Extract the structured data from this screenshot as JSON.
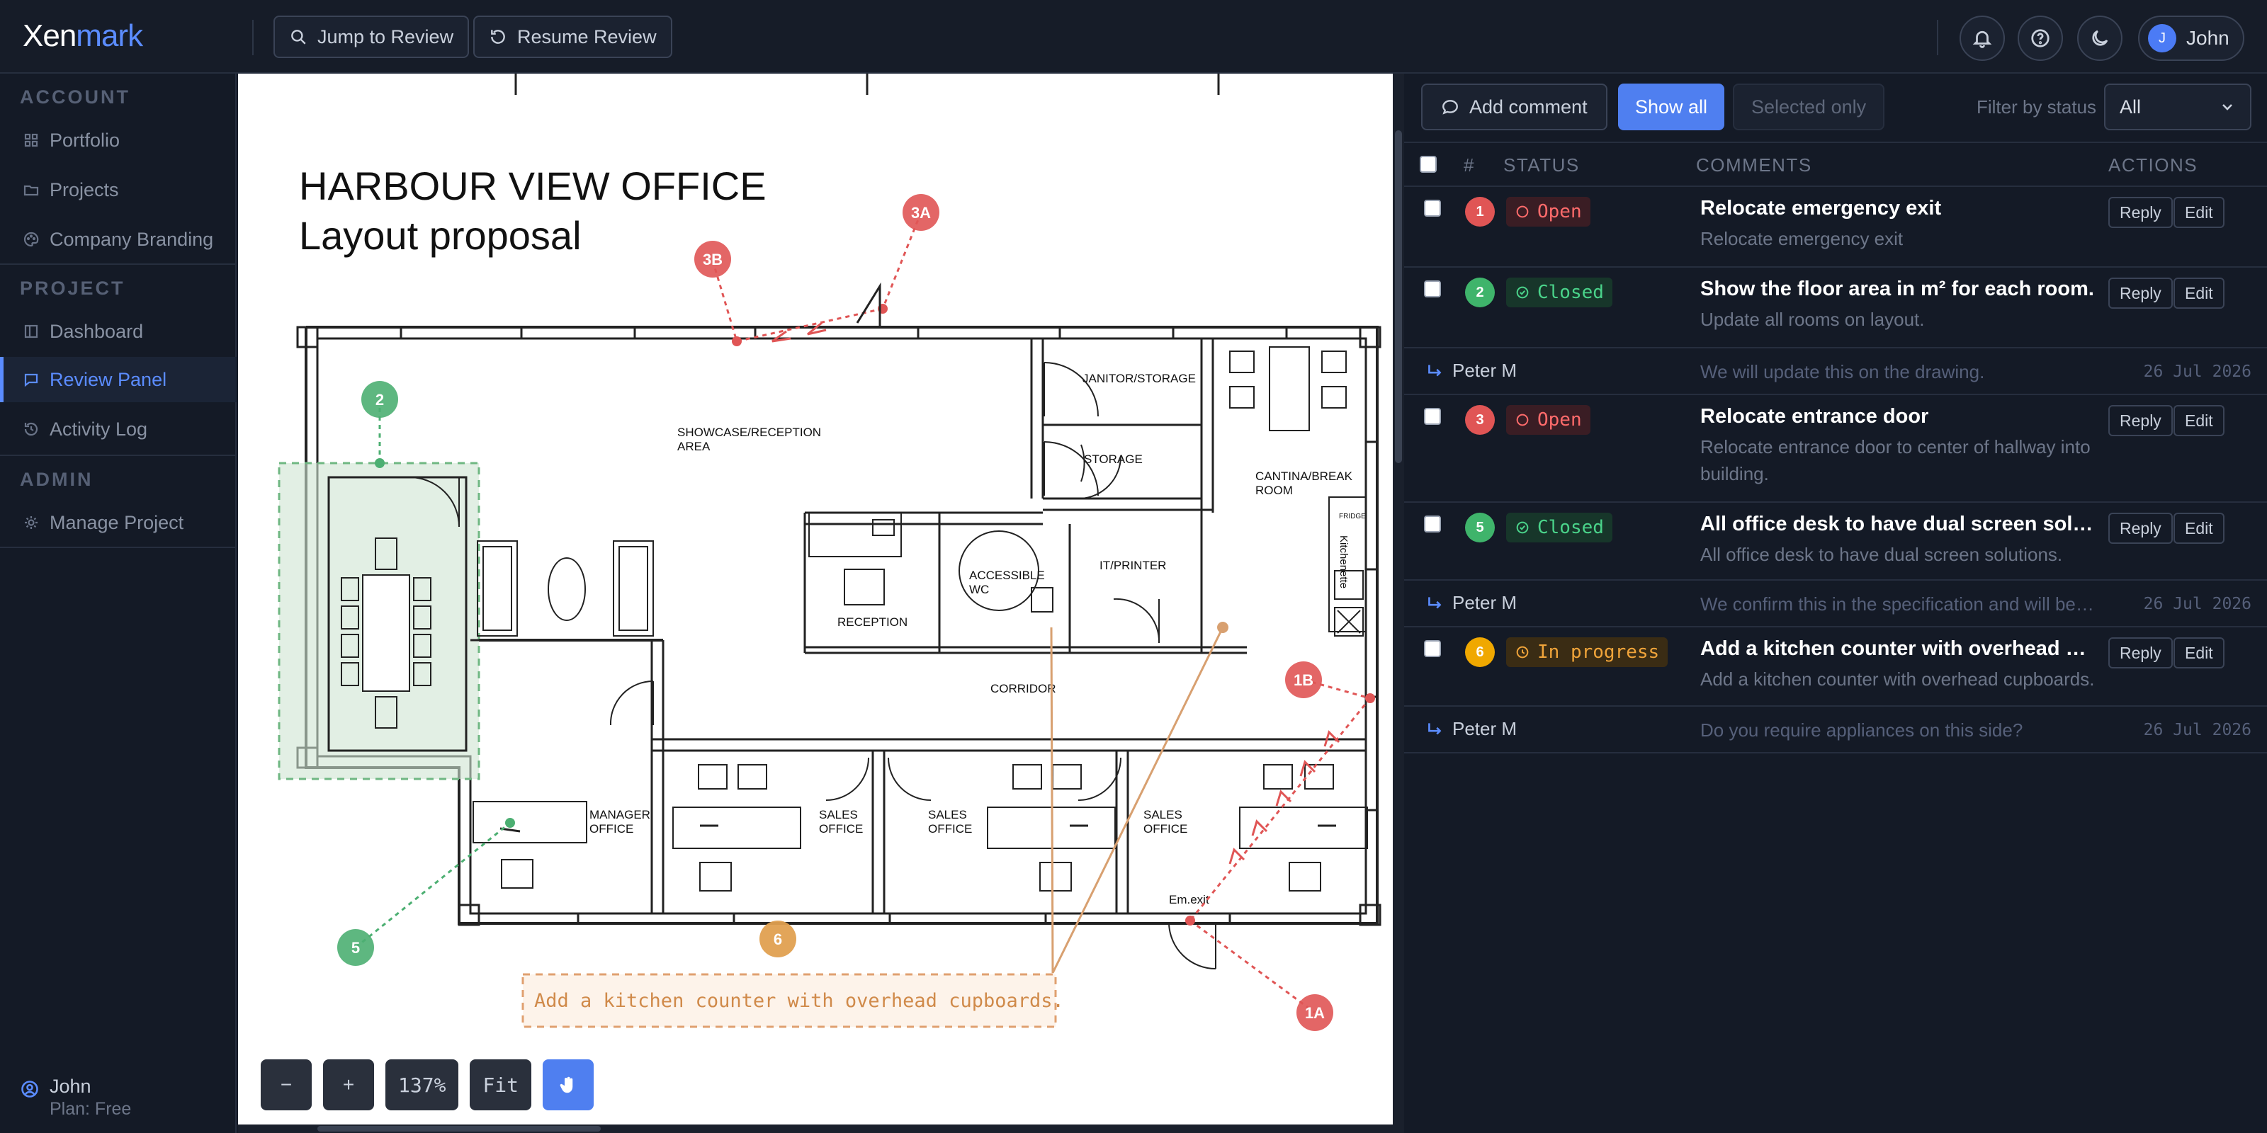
{
  "app": {
    "logo_text": "Xen",
    "logo_accent": "mark"
  },
  "toolbar": {
    "jump_label": "Jump to Review",
    "resume_label": "Resume Review",
    "bell_icon": "bell-icon",
    "help_icon": "help-icon",
    "theme_icon": "moon-icon",
    "user_name": "John",
    "user_initial": "J"
  },
  "sidebar": {
    "sections": [
      {
        "title": "ACCOUNT",
        "items": [
          {
            "label": "Portfolio",
            "icon": "grid-icon"
          },
          {
            "label": "Projects",
            "icon": "folder-icon"
          },
          {
            "label": "Company Branding",
            "icon": "palette-icon"
          }
        ]
      },
      {
        "title": "PROJECT",
        "items": [
          {
            "label": "Dashboard",
            "icon": "layout-icon"
          },
          {
            "label": "Review Panel",
            "icon": "comment-icon",
            "active": true
          },
          {
            "label": "Activity Log",
            "icon": "history-icon"
          }
        ]
      },
      {
        "title": "ADMIN",
        "items": [
          {
            "label": "Manage Project",
            "icon": "gear-icon"
          }
        ]
      }
    ],
    "user": {
      "name": "John",
      "plan": "Plan: Free"
    }
  },
  "drawing": {
    "title_line1": "HARBOUR VIEW OFFICE",
    "title_line2": "Layout proposal",
    "rooms": {
      "showcase": [
        "SHOWCASE/RECEPTION",
        "AREA"
      ],
      "janitor": "JANITOR/STORAGE",
      "storage": "STORAGE",
      "cantina": [
        "CANTINA/BREAK",
        "ROOM"
      ],
      "kitchenette": "Kitchenette",
      "fridge": "FRIDGE",
      "accessible": [
        "ACCESSIBLE",
        "WC"
      ],
      "it": "IT/PRINTER",
      "reception": "RECEPTION",
      "corridor": "CORRIDOR",
      "manager": [
        "MANAGER",
        "OFFICE"
      ],
      "sales1": [
        "SALES",
        "OFFICE"
      ],
      "sales2": [
        "SALES",
        "OFFICE"
      ],
      "sales3": [
        "SALES",
        "OFFICE"
      ],
      "emexit": "Em.exit"
    },
    "markers": [
      "3A",
      "3B",
      "2",
      "1B",
      "1A",
      "5",
      "6"
    ],
    "callout_text": "Add a kitchen counter with overhead cupboards.",
    "colors": {
      "open": "#e05555",
      "closed": "#4caf72",
      "progress": "#e0a050"
    }
  },
  "zoom": {
    "minus": "−",
    "plus": "+",
    "level": "137%",
    "fit": "Fit",
    "hand_icon": "hand-icon"
  },
  "panel": {
    "add_comment": "Add comment",
    "show_all": "Show all",
    "selected_only": "Selected only",
    "filter_label": "Filter by status",
    "filter_value": "All",
    "headers": {
      "num": "#",
      "status": "STATUS",
      "comments": "COMMENTS",
      "actions": "ACTIONS"
    },
    "reply_label": "Reply",
    "edit_label": "Edit",
    "comments": [
      {
        "num": "1",
        "status": "Open",
        "title": "Relocate emergency exit",
        "text": "Relocate emergency exit"
      },
      {
        "num": "2",
        "status": "Closed",
        "title": "Show the floor area in m² for each room.",
        "text": "Update all rooms on layout."
      },
      {
        "num": "3",
        "status": "Open",
        "title": "Relocate entrance door",
        "text": "Relocate entrance door to center of hallway into building."
      },
      {
        "num": "5",
        "status": "Closed",
        "title": "All office desk to have dual screen solutions.",
        "text": "All office desk to have dual screen solutions."
      },
      {
        "num": "6",
        "status": "In progress",
        "title": "Add a kitchen counter with overhead cupb...",
        "text": "Add a kitchen counter with overhead cupboards."
      }
    ],
    "replies": [
      {
        "author": "Peter M",
        "text": "We will update this on the drawing.",
        "date": "26 Jul 2026"
      },
      {
        "author": "Peter M",
        "text": "We confirm this in the specification and will be adde...",
        "date": "26 Jul 2026"
      },
      {
        "author": "Peter M",
        "text": "Do you require appliances on this side?",
        "date": "26 Jul 2026"
      }
    ]
  }
}
